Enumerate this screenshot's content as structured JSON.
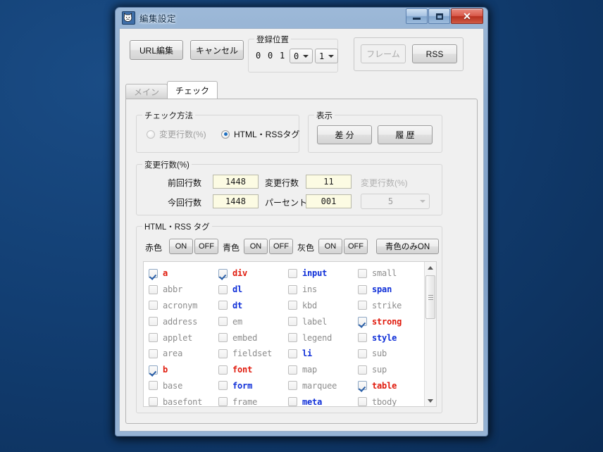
{
  "window": {
    "title": "編集設定",
    "icon": "cat-face-icon",
    "controls": {
      "minimize": "minimize-icon",
      "maximize": "maximize-icon",
      "close": "close-icon"
    }
  },
  "toolbar": {
    "url_edit": "URL編集",
    "cancel": "キャンセル",
    "position_group": "登録位置",
    "position_digits": [
      "0",
      "0",
      "1"
    ],
    "position_combo_a": "0",
    "position_combo_b": "1",
    "frame_button": "フレーム",
    "rss_button": "RSS"
  },
  "tabs": [
    {
      "label": "メイン",
      "selected": false
    },
    {
      "label": "チェック",
      "selected": true
    }
  ],
  "check_method": {
    "group": "チェック方法",
    "options": [
      {
        "label": "変更行数(%)",
        "selected": false,
        "disabled": true
      },
      {
        "label": "HTML・RSSタグ",
        "selected": true,
        "disabled": false
      }
    ]
  },
  "display": {
    "group": "表示",
    "diff_button": "差 分",
    "history_button": "履 歴"
  },
  "changed_lines": {
    "group": "変更行数(%)",
    "prev_label": "前回行数",
    "prev_value": "1448",
    "curr_label": "今回行数",
    "curr_value": "1448",
    "changed_label": "変更行数",
    "changed_value": "11",
    "percent_label": "パーセント",
    "percent_value": "001",
    "threshold_label": "変更行数(%)",
    "threshold_value": "5"
  },
  "tag_group": {
    "group": "HTML・RSS タグ",
    "red_label": "赤色",
    "blue_label": "青色",
    "gray_label": "灰色",
    "on": "ON",
    "off": "OFF",
    "blue_only_on": "青色のみON"
  },
  "tag_list": {
    "columns": [
      [
        {
          "name": "a",
          "checked": true,
          "color": "red"
        },
        {
          "name": "abbr",
          "checked": false,
          "color": "gray"
        },
        {
          "name": "acronym",
          "checked": false,
          "color": "gray"
        },
        {
          "name": "address",
          "checked": false,
          "color": "gray"
        },
        {
          "name": "applet",
          "checked": false,
          "color": "gray"
        },
        {
          "name": "area",
          "checked": false,
          "color": "gray"
        },
        {
          "name": "b",
          "checked": true,
          "color": "red"
        },
        {
          "name": "base",
          "checked": false,
          "color": "gray"
        },
        {
          "name": "basefont",
          "checked": false,
          "color": "gray"
        }
      ],
      [
        {
          "name": "div",
          "checked": true,
          "color": "red"
        },
        {
          "name": "dl",
          "checked": false,
          "color": "blue"
        },
        {
          "name": "dt",
          "checked": false,
          "color": "blue"
        },
        {
          "name": "em",
          "checked": false,
          "color": "gray"
        },
        {
          "name": "embed",
          "checked": false,
          "color": "gray"
        },
        {
          "name": "fieldset",
          "checked": false,
          "color": "gray"
        },
        {
          "name": "font",
          "checked": false,
          "color": "red"
        },
        {
          "name": "form",
          "checked": false,
          "color": "blue"
        },
        {
          "name": "frame",
          "checked": false,
          "color": "gray"
        }
      ],
      [
        {
          "name": "input",
          "checked": false,
          "color": "blue"
        },
        {
          "name": "ins",
          "checked": false,
          "color": "gray"
        },
        {
          "name": "kbd",
          "checked": false,
          "color": "gray"
        },
        {
          "name": "label",
          "checked": false,
          "color": "gray"
        },
        {
          "name": "legend",
          "checked": false,
          "color": "gray"
        },
        {
          "name": "li",
          "checked": false,
          "color": "blue"
        },
        {
          "name": "map",
          "checked": false,
          "color": "gray"
        },
        {
          "name": "marquee",
          "checked": false,
          "color": "gray"
        },
        {
          "name": "meta",
          "checked": false,
          "color": "blue"
        }
      ],
      [
        {
          "name": "small",
          "checked": false,
          "color": "gray"
        },
        {
          "name": "span",
          "checked": false,
          "color": "blue"
        },
        {
          "name": "strike",
          "checked": false,
          "color": "gray"
        },
        {
          "name": "strong",
          "checked": true,
          "color": "red"
        },
        {
          "name": "style",
          "checked": false,
          "color": "blue"
        },
        {
          "name": "sub",
          "checked": false,
          "color": "gray"
        },
        {
          "name": "sup",
          "checked": false,
          "color": "gray"
        },
        {
          "name": "table",
          "checked": true,
          "color": "red"
        },
        {
          "name": "tbody",
          "checked": false,
          "color": "gray"
        }
      ]
    ]
  },
  "colors": {
    "desktop": "#123e72",
    "tag_red": "#e01a0c",
    "tag_blue": "#0f2fd8",
    "tag_gray": "#8d8d8d",
    "field_bg": "#fcfbe3",
    "radio_accent": "#1f6fbf"
  }
}
